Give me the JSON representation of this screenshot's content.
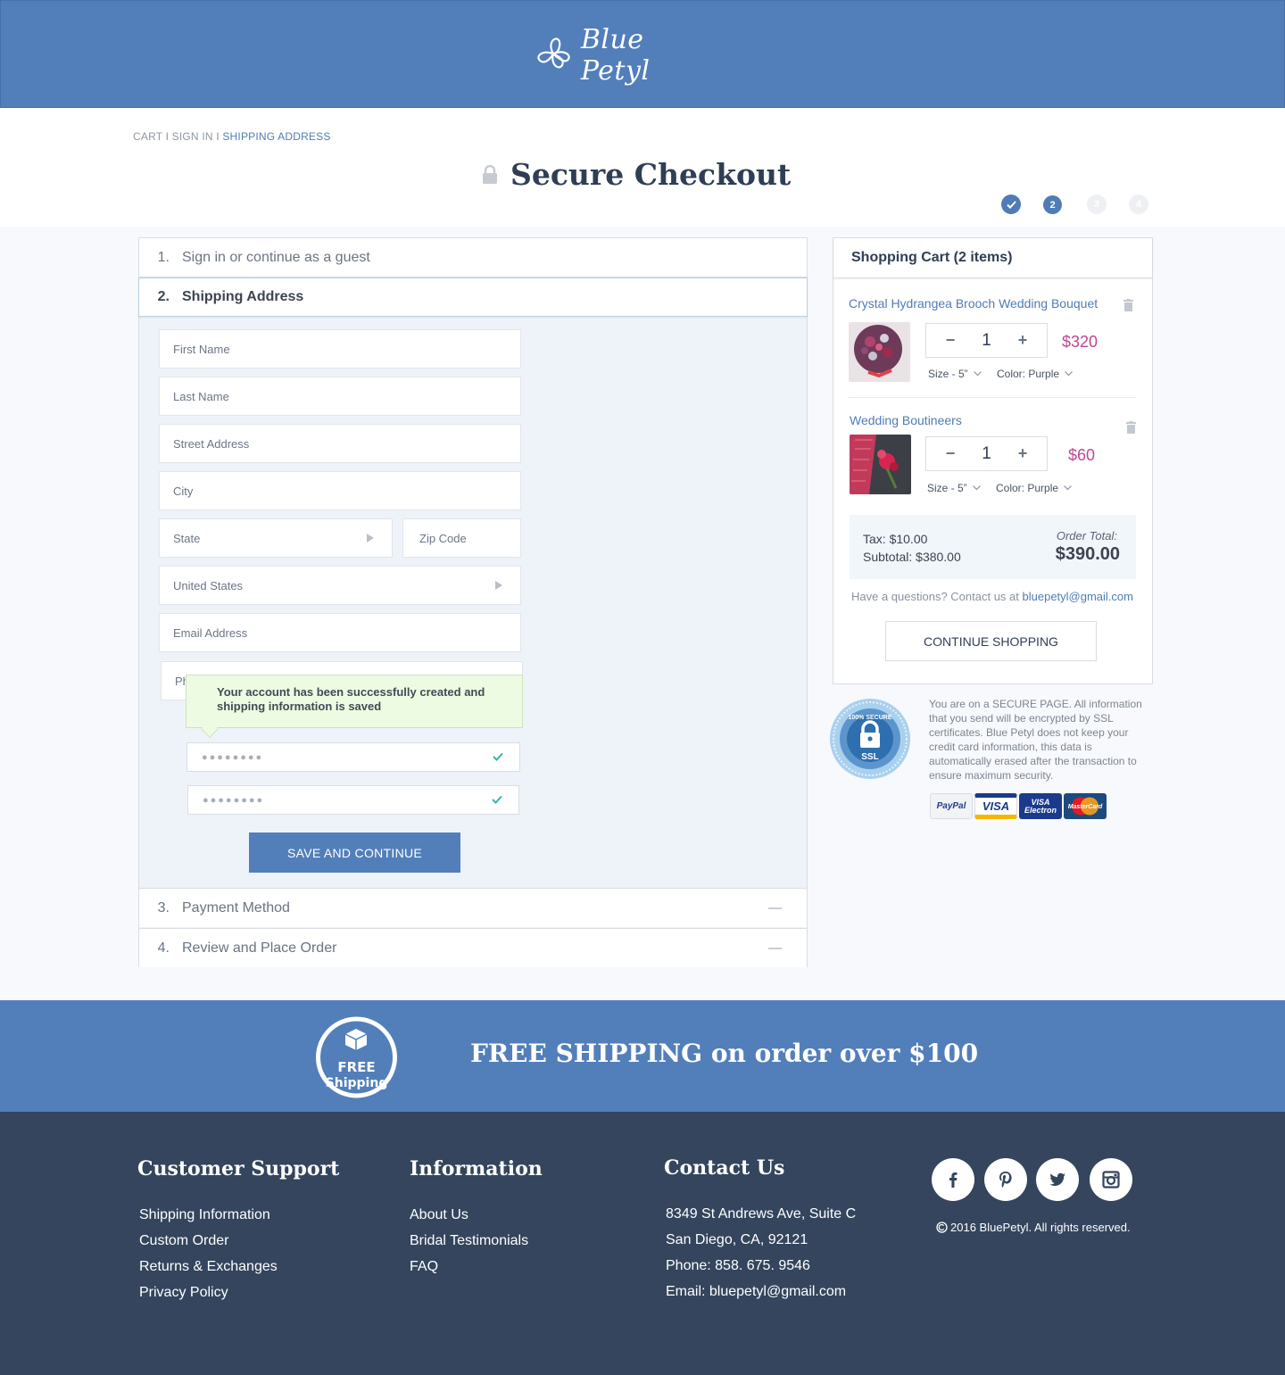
{
  "brand": {
    "name": "Blue Petyl"
  },
  "breadcrumb": {
    "cart": "CART I",
    "signin": "SIGN IN I",
    "current": "SHIPPING ADDRESS"
  },
  "page_title": "Secure Checkout",
  "steps": {
    "step2": "2",
    "step3": "3",
    "step4": "4"
  },
  "checkout": {
    "step1": {
      "num": "1.",
      "label": "Sign in or continue as a guest"
    },
    "step2": {
      "num": "2.",
      "label": "Shipping Address"
    },
    "step3": {
      "num": "3.",
      "label": "Payment Method"
    },
    "step4": {
      "num": "4.",
      "label": "Review and Place Order"
    },
    "fields": {
      "first_name": "First Name",
      "last_name": "Last Name",
      "street": "Street Address",
      "city": "City",
      "state": "State",
      "zip": "Zip Code",
      "country": "United States",
      "email": "Email Address",
      "phone_partial": "Ph"
    },
    "tooltip": "Your account has been successfully created and shipping information is saved",
    "password_mask": "●●●●●●●●",
    "password_confirm_mask": "●●●●●●●●",
    "save_label": "SAVE AND CONTINUE"
  },
  "cart": {
    "title": "Shopping Cart (2 items)",
    "items": [
      {
        "name": "Crystal Hydrangea Brooch Wedding Bouquet",
        "qty": "1",
        "price": "$320",
        "size": "Size - 5”",
        "color": "Color: Purple"
      },
      {
        "name": "Wedding Boutineers",
        "qty": "1",
        "price": "$60",
        "size": "Size - 5”",
        "color": "Color: Purple"
      }
    ],
    "tax": "Tax: $10.00",
    "subtotal": "Subtotal: $380.00",
    "order_total_label": "Order Total:",
    "order_total": "$390.00",
    "question": "Have a questions? Contact us at ",
    "email": "bluepetyl@gmail.com",
    "continue_label": "CONTINUE SHOPPING"
  },
  "security": {
    "badge_top": "100% SECURE",
    "badge_bottom": "SSL",
    "text": "You are on a SECURE PAGE. All information that you send will be encrypted by SSL certificates. Blue Petyl does not keep your credit card information, this data is automatically erased after the transaction to ensure maximum security.",
    "cards": {
      "paypal": "PayPal",
      "visa": "VISA",
      "electron_top": "VISA",
      "electron_bottom": "Electron",
      "master": "MasterCard"
    }
  },
  "shipping_banner": {
    "icon_top": "FREE",
    "icon_bottom": "Shipping",
    "text": "FREE SHIPPING on order over $100"
  },
  "footer": {
    "support": {
      "title": "Customer Support",
      "links": [
        "Shipping Information",
        "Custom Order",
        "Returns & Exchanges",
        "Privacy Policy"
      ]
    },
    "information": {
      "title": "Information",
      "links": [
        "About Us",
        "Bridal Testimonials",
        "FAQ"
      ]
    },
    "contact": {
      "title": "Contact Us",
      "lines": [
        "8349 St Andrews Ave, Suite C",
        "San Diego, CA, 92121",
        "Phone: 858. 675. 9546",
        "Email: bluepetyl@gmail.com"
      ]
    },
    "social": [
      "facebook-icon",
      "pinterest-icon",
      "twitter-icon",
      "instagram-icon"
    ],
    "copyright": "2016 BluePetyl. All rights reserved."
  },
  "colors": {
    "brand_blue": "#527fba",
    "footer_navy": "#34455d",
    "price_pink": "#c0468f"
  }
}
